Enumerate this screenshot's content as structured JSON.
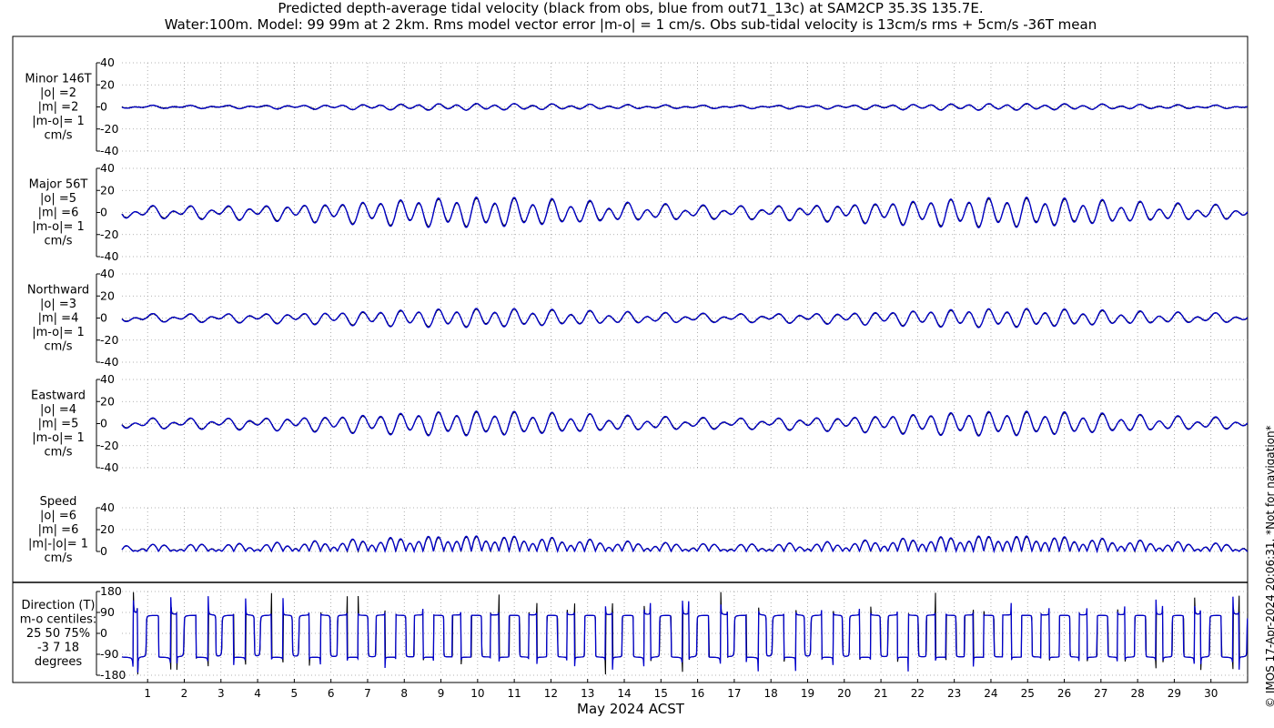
{
  "title_lines": [
    "Predicted depth-average tidal velocity (black from obs, blue from out71_13c) at SAM2CP 35.3S 135.7E.",
    "Water:100m. Model: 99 99m at 2 2km. Rms model vector error |m-o| = 1 cm/s. Obs sub-tidal velocity is 13cm/s rms + 5cm/s -36T mean"
  ],
  "side_note": "© IMOS 17-Apr-2024 20:06:31. *Not for navigation*",
  "colors": {
    "obs": "#000000",
    "model": "#0000cc",
    "grid": "#9a9a9a"
  },
  "chart_data": [
    {
      "type": "line",
      "panel": "minor",
      "ylabel_lines": [
        "Minor 146T",
        "|o| =2",
        "|m| =2",
        "|m-o|= 1",
        "cm/s"
      ],
      "ylim": [
        -40,
        40
      ],
      "yticks": [
        40,
        20,
        0,
        -20,
        -40
      ],
      "amplitude_cm_s": {
        "obs": 2,
        "model": 2
      }
    },
    {
      "type": "line",
      "panel": "major",
      "ylabel_lines": [
        "Major 56T",
        "|o| =5",
        "|m| =6",
        "|m-o|= 1",
        "cm/s"
      ],
      "ylim": [
        -40,
        40
      ],
      "yticks": [
        40,
        20,
        0,
        -20,
        -40
      ],
      "amplitude_cm_s": {
        "obs": 5,
        "model": 6
      }
    },
    {
      "type": "line",
      "panel": "northward",
      "ylabel_lines": [
        "Northward",
        "|o| =3",
        "|m| =4",
        "|m-o|= 1",
        "cm/s"
      ],
      "ylim": [
        -40,
        40
      ],
      "yticks": [
        40,
        20,
        0,
        -20,
        -40
      ],
      "amplitude_cm_s": {
        "obs": 3,
        "model": 4
      }
    },
    {
      "type": "line",
      "panel": "eastward",
      "ylabel_lines": [
        "Eastward",
        "|o| =4",
        "|m| =5",
        "|m-o|= 1",
        "cm/s"
      ],
      "ylim": [
        -40,
        40
      ],
      "yticks": [
        40,
        20,
        0,
        -20,
        -40
      ],
      "amplitude_cm_s": {
        "obs": 4,
        "model": 5
      }
    },
    {
      "type": "line",
      "panel": "speed",
      "ylabel_lines": [
        "Speed",
        "|o| =6",
        "|m| =6",
        "|m|-|o|= 1",
        "cm/s"
      ],
      "ylim": [
        0,
        40
      ],
      "yticks": [
        40,
        20,
        0
      ],
      "amplitude_cm_s": {
        "obs": 6,
        "model": 6
      }
    },
    {
      "type": "line",
      "panel": "direction",
      "ylabel_lines": [
        "Direction (T)",
        "m-o centiles:",
        "25  50  75%",
        "-3   7  18",
        "degrees"
      ],
      "ylim": [
        -180,
        180
      ],
      "yticks": [
        180,
        90,
        0,
        -90,
        -180
      ]
    }
  ],
  "x_axis": {
    "label": "May 2024 ACST",
    "start_day": 0.3,
    "end_day": 31.0,
    "ticks": [
      1,
      2,
      3,
      4,
      5,
      6,
      7,
      8,
      9,
      10,
      11,
      12,
      13,
      14,
      15,
      16,
      17,
      18,
      19,
      20,
      21,
      22,
      23,
      24,
      25,
      26,
      27,
      28,
      29,
      30
    ],
    "tick_labels": [
      "1",
      "2",
      "3",
      "4",
      "5",
      "6",
      "7",
      "8",
      "9",
      "10",
      "11",
      "12",
      "13",
      "14",
      "15",
      "16",
      "17",
      "18",
      "19",
      "20",
      "21",
      "22",
      "23",
      "24",
      "25",
      "26",
      "27",
      "28",
      "29",
      "30"
    ]
  },
  "series_signal": {
    "spring_neap_peaks_day": [
      9.8,
      24.3
    ],
    "diurnal_period_days": 1.0,
    "semidiurnal_period_days": 0.5175
  }
}
